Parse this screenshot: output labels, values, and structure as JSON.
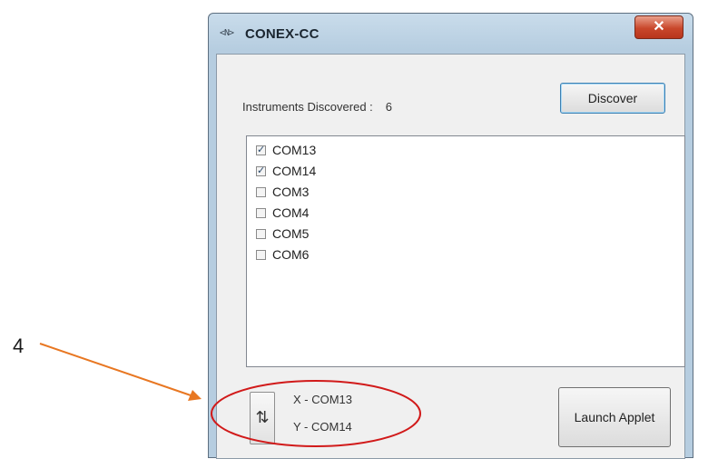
{
  "annotation": {
    "number": "4"
  },
  "window": {
    "title": "CONEX-CC",
    "icon_glyph": "<N>",
    "close_glyph": "✕"
  },
  "discovery": {
    "label": "Instruments Discovered :",
    "count": "6",
    "discover_button": "Discover"
  },
  "instruments": [
    {
      "name": "COM13",
      "checked": true
    },
    {
      "name": "COM14",
      "checked": true
    },
    {
      "name": "COM3",
      "checked": false
    },
    {
      "name": "COM4",
      "checked": false
    },
    {
      "name": "COM5",
      "checked": false
    },
    {
      "name": "COM6",
      "checked": false
    }
  ],
  "axes": {
    "swap_glyph": "⇅",
    "x_label": "X - COM13",
    "y_label": "Y - COM14"
  },
  "launch_button": "Launch Applet",
  "colors": {
    "arrow": "#e87722",
    "ellipse": "#d11a1a"
  }
}
